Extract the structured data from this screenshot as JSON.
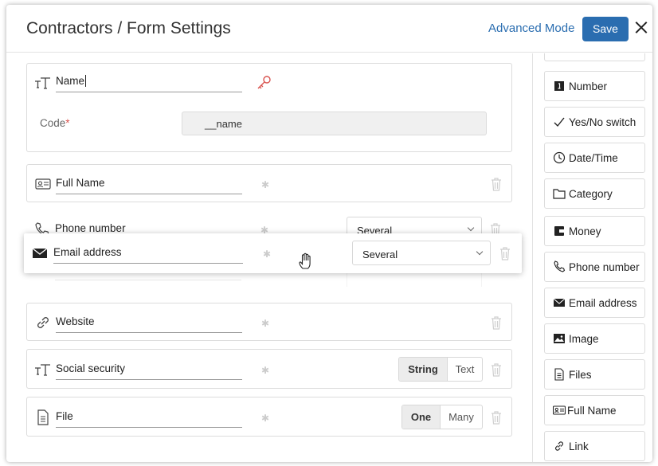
{
  "header": {
    "title": "Contractors / Form Settings",
    "advanced_mode": "Advanced Mode",
    "save": "Save"
  },
  "name_card": {
    "value": "Name",
    "code_label": "Code",
    "code_value": "__name"
  },
  "fields": [
    {
      "label": "Full Name",
      "icon": "id-card-icon"
    },
    {
      "label": "Phone number",
      "icon": "phone-icon",
      "select": "Several"
    },
    {
      "label": "Email address",
      "icon": "envelope-icon",
      "select": "Several"
    },
    {
      "label": "Website",
      "icon": "link-icon"
    },
    {
      "label": "Social security",
      "icon": "text-type-icon",
      "seg": [
        "String",
        "Text"
      ]
    },
    {
      "label": "File",
      "icon": "file-icon",
      "seg": [
        "One",
        "Many"
      ]
    }
  ],
  "dragging": {
    "label": "Email address",
    "select": "Several"
  },
  "palette": [
    "Number",
    "Yes/No switch",
    "Date/Time",
    "Category",
    "Money",
    "Phone number",
    "Email address",
    "Image",
    "Files",
    "Full Name",
    "Link"
  ],
  "colors": {
    "accent": "#2a6db0",
    "key_icon": "#d9534f",
    "required": "#d9534f"
  }
}
